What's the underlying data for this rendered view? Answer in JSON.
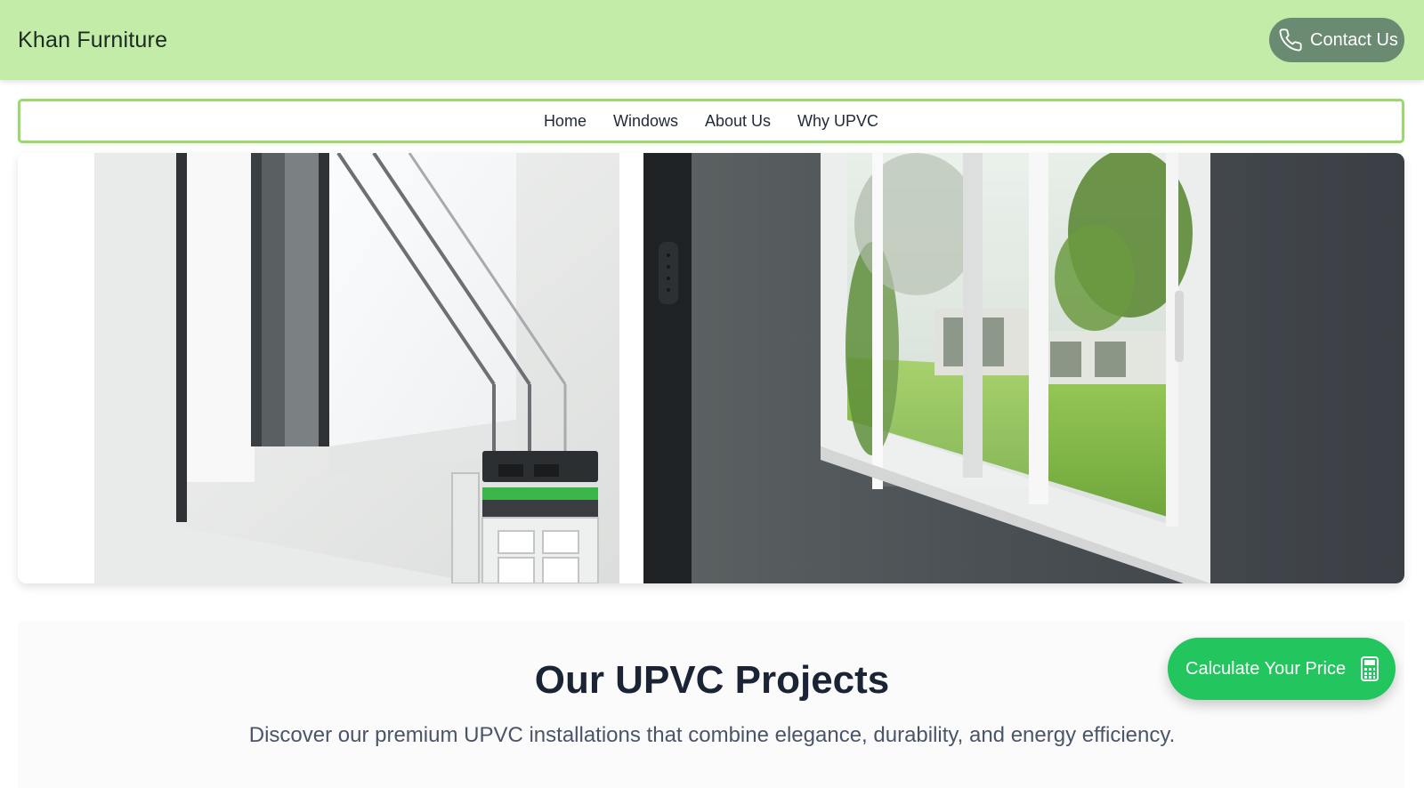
{
  "header": {
    "brand": "Khan Furniture",
    "contact_label": "Contact Us",
    "contact_icon": "phone-icon"
  },
  "nav": {
    "items": [
      {
        "label": "Home"
      },
      {
        "label": "Windows"
      },
      {
        "label": "About Us"
      },
      {
        "label": "Why UPVC"
      }
    ]
  },
  "hero": {
    "left_image": "upvc-window-profile-cross-section",
    "right_image": "sliding-window-garden-view"
  },
  "projects": {
    "title": "Our UPVC Projects",
    "subtitle": "Discover our premium UPVC installations that combine elegance, durability, and energy efficiency."
  },
  "calculator": {
    "label": "Calculate Your Price",
    "icon": "calculator-icon"
  },
  "colors": {
    "header_bg": "#c2eca8",
    "contact_button": "#6b8a72",
    "nav_border": "#9ad96a",
    "cta_green": "#22c55e"
  }
}
